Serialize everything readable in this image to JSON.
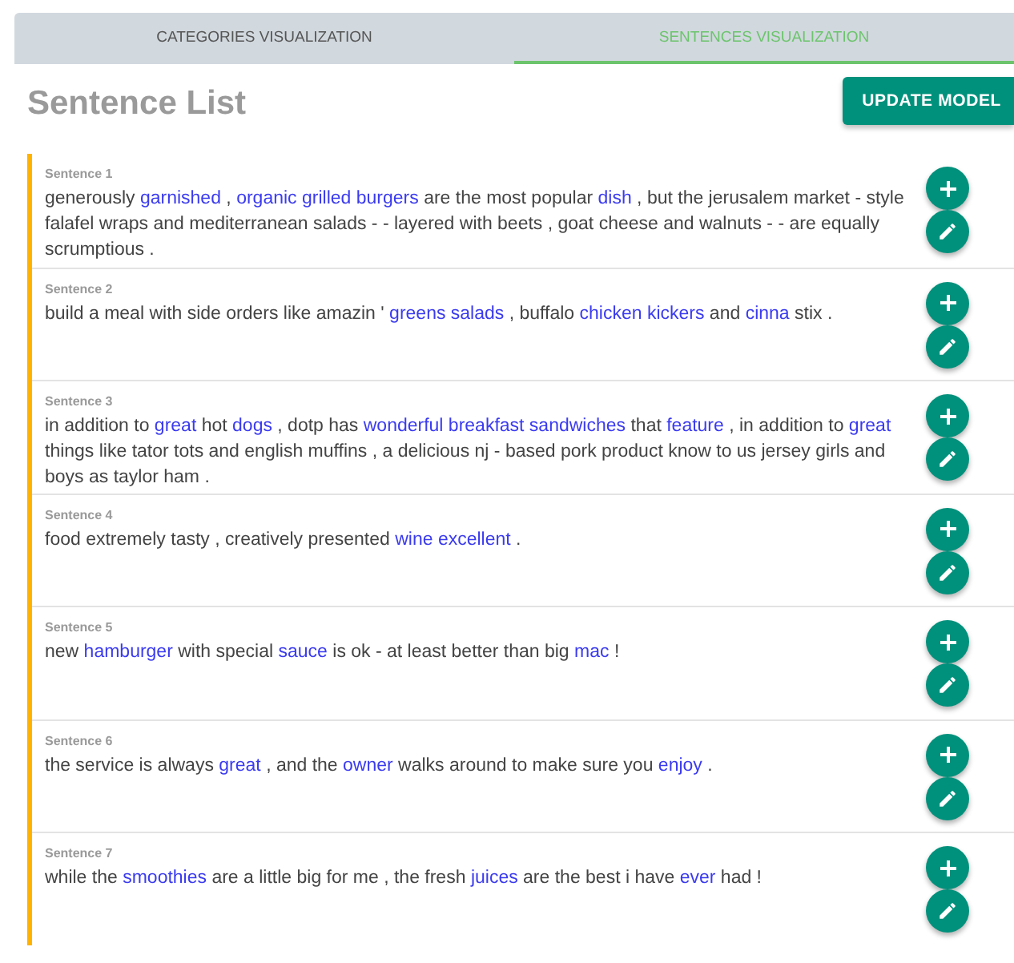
{
  "tabs": [
    {
      "label": "CATEGORIES VISUALIZATION",
      "selected": false
    },
    {
      "label": "SENTENCES VISUALIZATION",
      "selected": true
    }
  ],
  "title": "Sentence List",
  "update_button": "UPDATE MODEL",
  "sentences": [
    {
      "label": "Sentence 1",
      "segments": [
        {
          "text": "generously ",
          "highlighted": false
        },
        {
          "text": "garnished",
          "highlighted": true
        },
        {
          "text": " , ",
          "highlighted": false
        },
        {
          "text": "organic grilled burgers",
          "highlighted": true
        },
        {
          "text": " are the most popular ",
          "highlighted": false
        },
        {
          "text": "dish",
          "highlighted": true
        },
        {
          "text": " , but the jerusalem market - style falafel wraps and mediterranean salads - - layered with beets , goat cheese and walnuts - - are equally scrumptious .",
          "highlighted": false
        }
      ]
    },
    {
      "label": "Sentence 2",
      "segments": [
        {
          "text": "build a meal with side orders like amazin ' ",
          "highlighted": false
        },
        {
          "text": "greens salads",
          "highlighted": true
        },
        {
          "text": " , buffalo ",
          "highlighted": false
        },
        {
          "text": "chicken kickers",
          "highlighted": true
        },
        {
          "text": " and ",
          "highlighted": false
        },
        {
          "text": "cinna",
          "highlighted": true
        },
        {
          "text": " stix .",
          "highlighted": false
        }
      ]
    },
    {
      "label": "Sentence 3",
      "segments": [
        {
          "text": "in addition to ",
          "highlighted": false
        },
        {
          "text": "great",
          "highlighted": true
        },
        {
          "text": " hot ",
          "highlighted": false
        },
        {
          "text": "dogs",
          "highlighted": true
        },
        {
          "text": " , dotp has ",
          "highlighted": false
        },
        {
          "text": "wonderful breakfast sandwiches",
          "highlighted": true
        },
        {
          "text": " that ",
          "highlighted": false
        },
        {
          "text": "feature",
          "highlighted": true
        },
        {
          "text": " , in addition to ",
          "highlighted": false
        },
        {
          "text": "great",
          "highlighted": true
        },
        {
          "text": " things like tator tots and english muffins , a delicious nj - based pork product know to us jersey girls and boys as taylor ham .",
          "highlighted": false
        }
      ]
    },
    {
      "label": "Sentence 4",
      "segments": [
        {
          "text": "food extremely tasty , creatively presented ",
          "highlighted": false
        },
        {
          "text": "wine excellent",
          "highlighted": true
        },
        {
          "text": " .",
          "highlighted": false
        }
      ]
    },
    {
      "label": "Sentence 5",
      "segments": [
        {
          "text": "new ",
          "highlighted": false
        },
        {
          "text": "hamburger",
          "highlighted": true
        },
        {
          "text": " with special ",
          "highlighted": false
        },
        {
          "text": "sauce",
          "highlighted": true
        },
        {
          "text": " is ok - at least better than big ",
          "highlighted": false
        },
        {
          "text": "mac",
          "highlighted": true
        },
        {
          "text": " !",
          "highlighted": false
        }
      ]
    },
    {
      "label": "Sentence 6",
      "segments": [
        {
          "text": "the service is always ",
          "highlighted": false
        },
        {
          "text": "great",
          "highlighted": true
        },
        {
          "text": " , and the ",
          "highlighted": false
        },
        {
          "text": "owner",
          "highlighted": true
        },
        {
          "text": " walks around to make sure you ",
          "highlighted": false
        },
        {
          "text": "enjoy",
          "highlighted": true
        },
        {
          "text": " .",
          "highlighted": false
        }
      ]
    },
    {
      "label": "Sentence 7",
      "segments": [
        {
          "text": "while the ",
          "highlighted": false
        },
        {
          "text": "smoothies",
          "highlighted": true
        },
        {
          "text": " are a little big for me , the fresh ",
          "highlighted": false
        },
        {
          "text": "juices",
          "highlighted": true
        },
        {
          "text": " are the best i have ",
          "highlighted": false
        },
        {
          "text": "ever",
          "highlighted": true
        },
        {
          "text": " had !",
          "highlighted": false
        }
      ]
    }
  ]
}
